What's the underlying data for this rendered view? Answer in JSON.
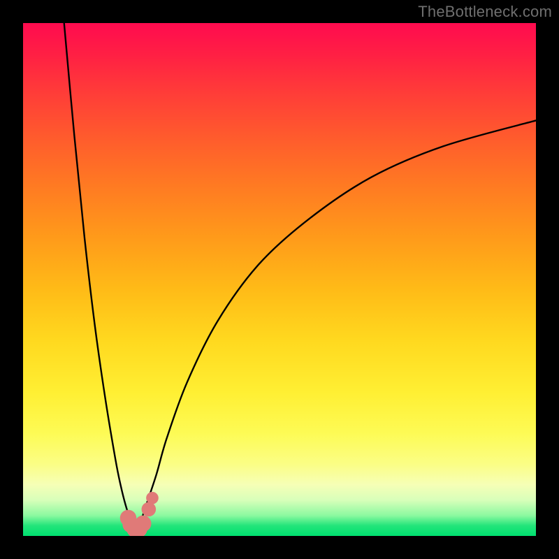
{
  "watermark": {
    "text": "TheBottleneck.com"
  },
  "colors": {
    "frame": "#000000",
    "curve": "#000000",
    "marker": "#e07a78",
    "gradient_top": "#ff0b4f",
    "gradient_bottom": "#00df70"
  },
  "chart_data": {
    "type": "line",
    "title": "",
    "xlabel": "",
    "ylabel": "",
    "xlim": [
      0,
      100
    ],
    "ylim": [
      0,
      100
    ],
    "grid": false,
    "legend": false,
    "series": [
      {
        "name": "left-branch",
        "x": [
          8,
          10,
          12,
          14,
          16,
          18,
          19,
          20,
          21,
          22
        ],
        "y": [
          100,
          78,
          58,
          41,
          27,
          15,
          10,
          6,
          3,
          1
        ]
      },
      {
        "name": "right-branch",
        "x": [
          22,
          23,
          24,
          26,
          28,
          32,
          38,
          46,
          56,
          68,
          82,
          100
        ],
        "y": [
          1,
          3,
          6,
          12,
          19,
          30,
          42,
          53,
          62,
          70,
          76,
          81
        ]
      }
    ],
    "markers": [
      {
        "x": 20.5,
        "y": 3.5,
        "r": 1.6
      },
      {
        "x": 21.0,
        "y": 2.2,
        "r": 1.6
      },
      {
        "x": 21.8,
        "y": 1.3,
        "r": 1.6
      },
      {
        "x": 22.6,
        "y": 1.3,
        "r": 1.6
      },
      {
        "x": 23.4,
        "y": 2.4,
        "r": 1.6
      },
      {
        "x": 24.5,
        "y": 5.2,
        "r": 1.4
      },
      {
        "x": 25.2,
        "y": 7.4,
        "r": 1.2
      }
    ]
  }
}
